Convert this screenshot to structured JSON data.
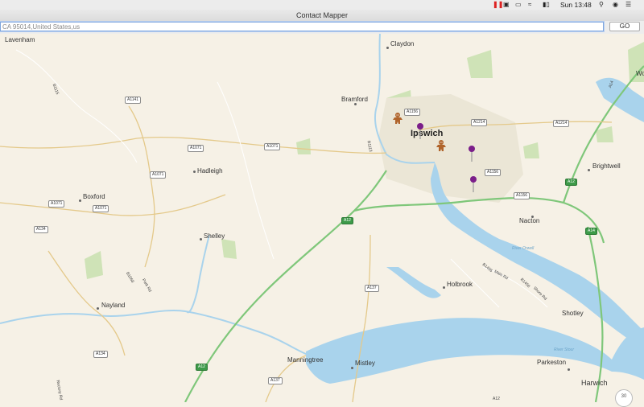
{
  "menubar": {
    "clock": "Sun 13:48",
    "icons": [
      "pause-icon",
      "screen-share-icon",
      "airplay-icon",
      "wifi-icon",
      "battery-icon",
      "search-icon",
      "user-icon",
      "list-icon"
    ]
  },
  "window": {
    "title": "Contact Mapper"
  },
  "search": {
    "value": "CA 95014,United States,us",
    "go_label": "GO"
  },
  "map": {
    "places": [
      {
        "name": "Lavenham",
        "kind": "town"
      },
      {
        "name": "Claydon",
        "kind": "town"
      },
      {
        "name": "Bramford",
        "kind": "town"
      },
      {
        "name": "Ipswich",
        "kind": "city"
      },
      {
        "name": "Hadleigh",
        "kind": "town"
      },
      {
        "name": "Boxford",
        "kind": "town"
      },
      {
        "name": "Shelley",
        "kind": "town"
      },
      {
        "name": "Nayland",
        "kind": "town"
      },
      {
        "name": "Holbrook",
        "kind": "town"
      },
      {
        "name": "Nacton",
        "kind": "town"
      },
      {
        "name": "Brightwell",
        "kind": "town"
      },
      {
        "name": "Shotley",
        "kind": "town"
      },
      {
        "name": "Manningtree",
        "kind": "town"
      },
      {
        "name": "Mistley",
        "kind": "town"
      },
      {
        "name": "Parkeston",
        "kind": "town"
      },
      {
        "name": "Harwich",
        "kind": "town"
      },
      {
        "name": "Wo",
        "kind": "town"
      }
    ],
    "roads": [
      "A1141",
      "A1071",
      "A1071",
      "A1071",
      "A1071",
      "A1071",
      "A134",
      "A134",
      "A1156",
      "A1214",
      "A1214",
      "A1156",
      "A1156",
      "A12",
      "A12",
      "A14",
      "A12",
      "A137",
      "A137",
      "B1115",
      "B1113",
      "B1068",
      "B1456",
      "B1456",
      "A12",
      "A14"
    ],
    "roads_secondary": [
      "Park Rd",
      "Main Rd",
      "Shore Rd",
      "Rectory Rd"
    ],
    "water": [
      "River Orwell",
      "River Stour"
    ],
    "compass_value": "30"
  }
}
